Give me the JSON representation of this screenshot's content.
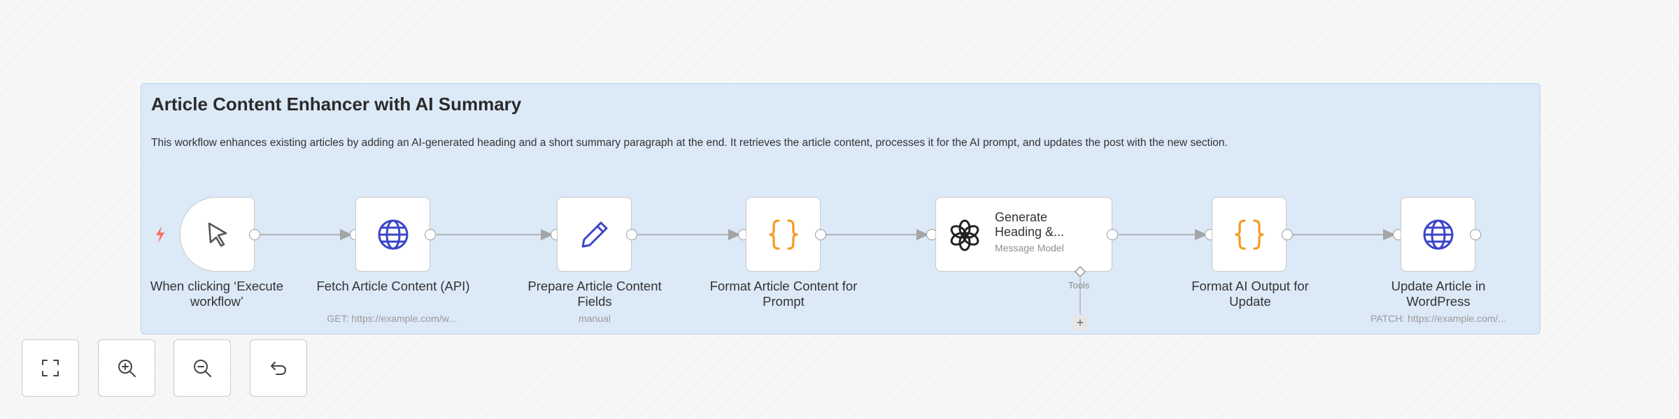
{
  "sticky": {
    "title": "Article Content Enhancer with AI Summary",
    "description": "This workflow enhances existing articles by adding an AI-generated heading and a short summary paragraph at the end. It retrieves the article content, processes it for the AI prompt, and updates the post with the new section."
  },
  "nodes": {
    "trigger": {
      "label": "When clicking ‘Execute workflow’",
      "icon": "cursor-icon"
    },
    "fetch": {
      "label": "Fetch Article Content (API)",
      "sublabel": "GET: https://example.com/w...",
      "icon": "globe-icon"
    },
    "prepare": {
      "label": "Prepare Article Content Fields",
      "sublabel": "manual",
      "icon": "pencil-icon"
    },
    "format_prompt": {
      "label": "Format Article Content for Prompt",
      "icon": "code-braces-icon"
    },
    "ai": {
      "title": "Generate Heading &...",
      "subtitle": "Message Model",
      "tools_label": "Tools",
      "icon": "openai-icon"
    },
    "format_output": {
      "label": "Format AI Output for Update",
      "icon": "code-braces-icon"
    },
    "update": {
      "label": "Update Article in WordPress",
      "sublabel": "PATCH: https://example.com/...",
      "icon": "globe-icon"
    }
  },
  "controls": {
    "fit_view": "expand-icon",
    "zoom_in": "zoom-in-icon",
    "zoom_out": "zoom-out-icon",
    "reset": "undo-icon"
  },
  "colors": {
    "sticky_bg": "#dce9f7",
    "globe": "#3b45c9",
    "braces": "#f59a23",
    "trigger_bolt": "#ff6d5a"
  }
}
